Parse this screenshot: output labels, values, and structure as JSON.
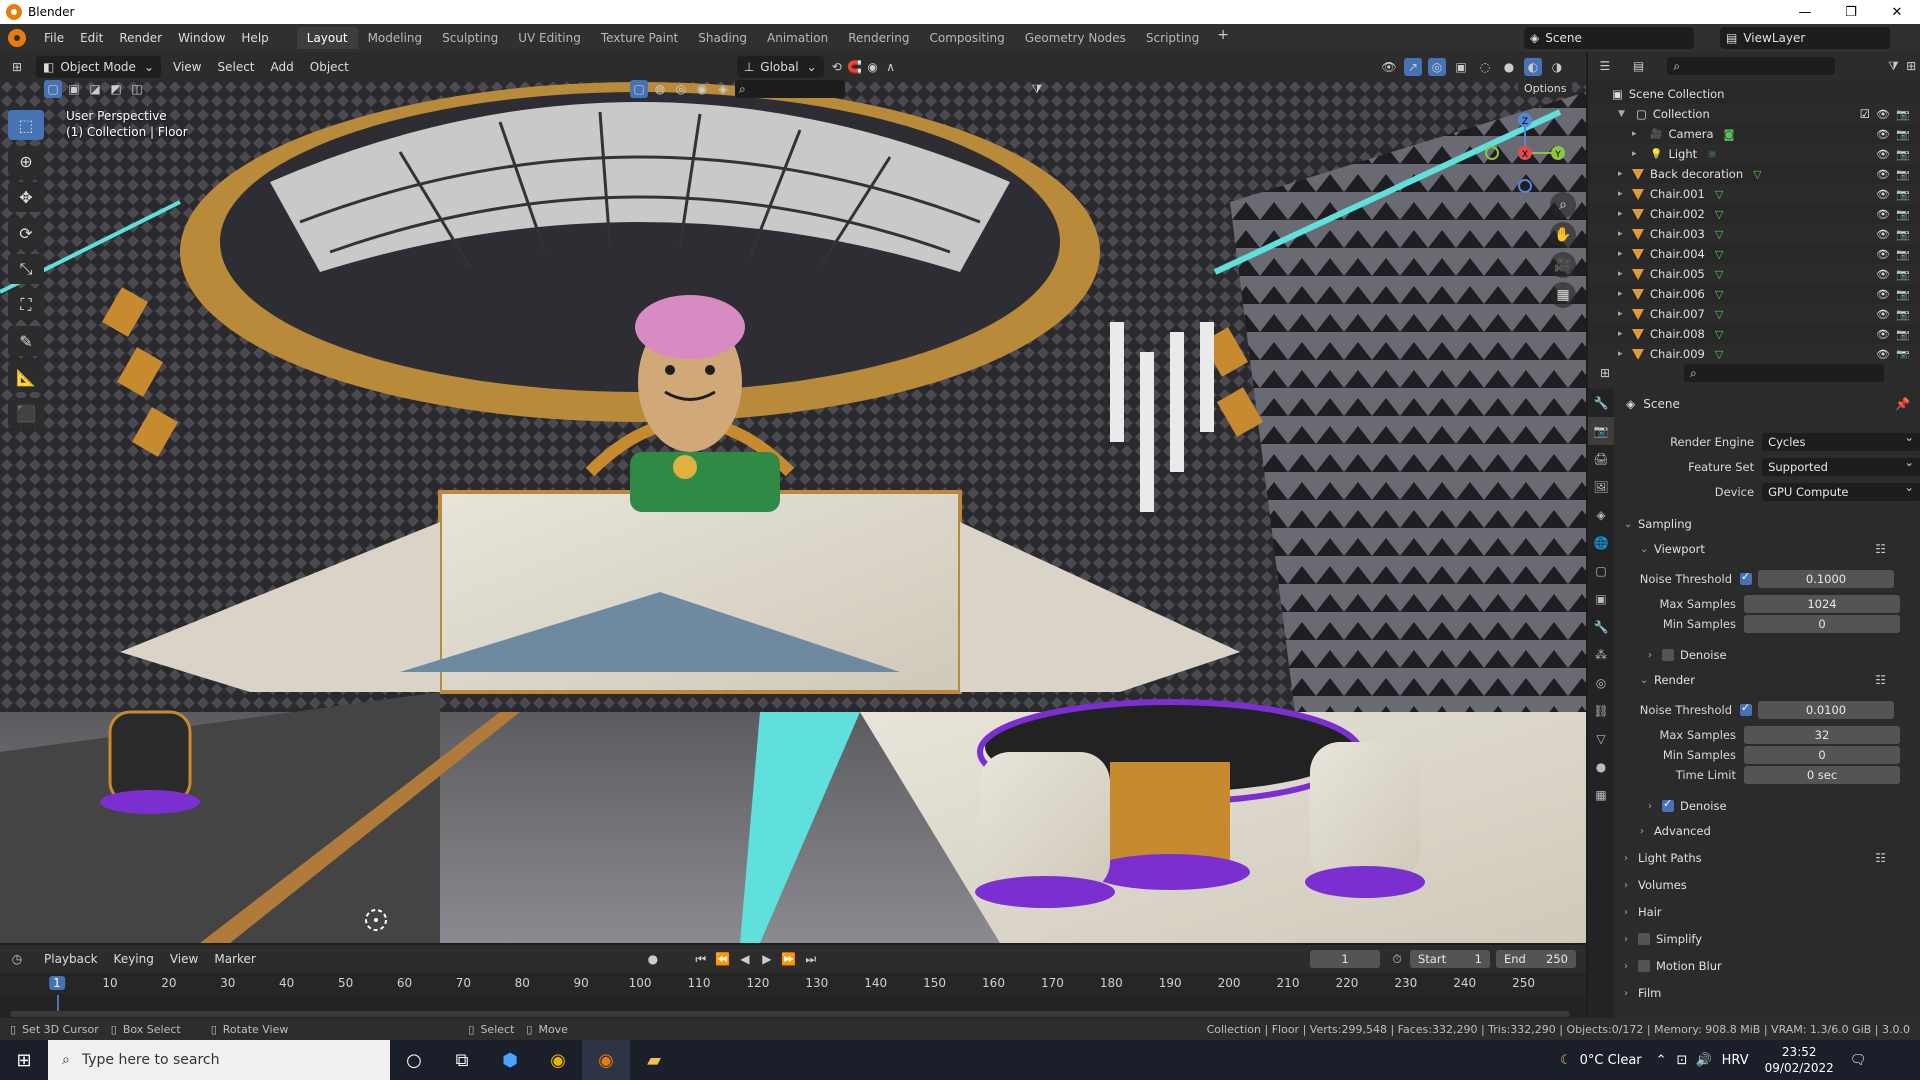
{
  "window": {
    "title": "Blender"
  },
  "menu": [
    "File",
    "Edit",
    "Render",
    "Window",
    "Help"
  ],
  "workspaces": [
    "Layout",
    "Modeling",
    "Sculpting",
    "UV Editing",
    "Texture Paint",
    "Shading",
    "Animation",
    "Rendering",
    "Compositing",
    "Geometry Nodes",
    "Scripting"
  ],
  "workspace_plus": "+",
  "scene_name": "Scene",
  "view_layer": "ViewLayer",
  "viewport": {
    "mode": "Object Mode",
    "menus": [
      "View",
      "Select",
      "Add",
      "Object"
    ],
    "orientation": "Global",
    "perspective": "User Perspective",
    "context": "(1) Collection | Floor",
    "options": "Options"
  },
  "gizmo": {
    "z": "Z",
    "y": "Y",
    "x": "X"
  },
  "timeline": {
    "menus": [
      "Playback",
      "Keying",
      "View",
      "Marker"
    ],
    "current_frame": "1",
    "start_label": "Start",
    "start": "1",
    "end_label": "End",
    "end": "250",
    "ticks": [
      "1",
      "10",
      "20",
      "30",
      "40",
      "50",
      "60",
      "70",
      "80",
      "90",
      "100",
      "110",
      "120",
      "130",
      "140",
      "150",
      "160",
      "170",
      "180",
      "190",
      "200",
      "210",
      "220",
      "230",
      "240",
      "250"
    ]
  },
  "status": {
    "hints": [
      "Set 3D Cursor",
      "Box Select",
      "Rotate View",
      "Select",
      "Move"
    ],
    "stats": "Collection | Floor | Verts:299,548 | Faces:332,290 | Tris:332,290 | Objects:0/172 | Memory: 908.8 MiB | VRAM: 1.3/6.0 GiB | 3.0.0"
  },
  "outliner": {
    "root": "Scene Collection",
    "collection": "Collection",
    "items": [
      "Camera",
      "Light",
      "Back decoration",
      "Chair.001",
      "Chair.002",
      "Chair.003",
      "Chair.004",
      "Chair.005",
      "Chair.006",
      "Chair.007",
      "Chair.008",
      "Chair.009"
    ]
  },
  "properties": {
    "context": "Scene",
    "render_engine_label": "Render Engine",
    "render_engine": "Cycles",
    "feature_set_label": "Feature Set",
    "feature_set": "Supported",
    "device_label": "Device",
    "device": "GPU Compute",
    "sampling": "Sampling",
    "viewport": "Viewport",
    "vp_noise_label": "Noise Threshold",
    "vp_noise": "0.1000",
    "vp_max_label": "Max Samples",
    "vp_max": "1024",
    "vp_min_label": "Min Samples",
    "vp_min": "0",
    "denoise": "Denoise",
    "render": "Render",
    "r_noise_label": "Noise Threshold",
    "r_noise": "0.0100",
    "r_max_label": "Max Samples",
    "r_max": "32",
    "r_min_label": "Min Samples",
    "r_min": "0",
    "r_time_label": "Time Limit",
    "r_time": "0 sec",
    "r_denoise": "Denoise",
    "advanced": "Advanced",
    "light_paths": "Light Paths",
    "volumes": "Volumes",
    "hair": "Hair",
    "simplify": "Simplify",
    "motion_blur": "Motion Blur",
    "film": "Film"
  },
  "taskbar": {
    "search_placeholder": "Type here to search",
    "weather": "0°C  Clear",
    "lang": "HRV",
    "time": "23:52",
    "date": "09/02/2022"
  },
  "colors": {
    "accent": "#4772b3",
    "blender_orange": "#e87d0d",
    "mesh_green": "#59c35a"
  }
}
